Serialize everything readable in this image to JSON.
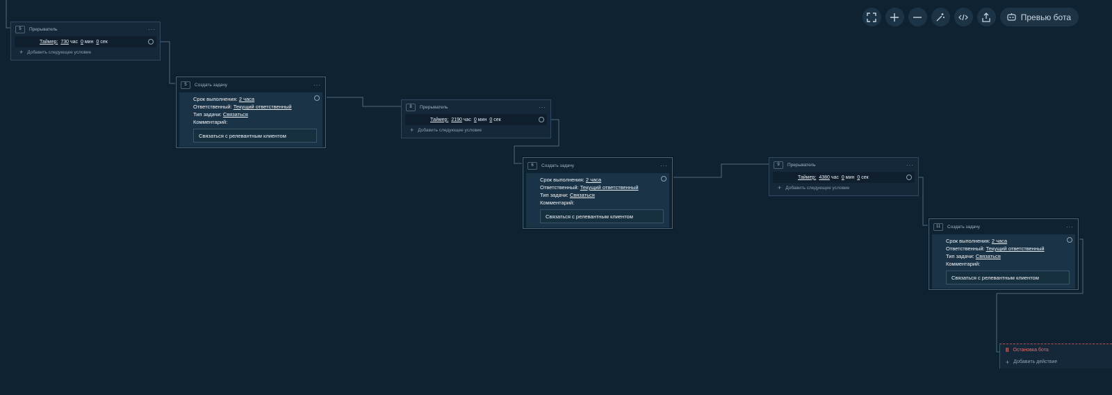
{
  "toolbar": {
    "preview_label": "Превью бота",
    "icons": [
      "fullscreen-icon",
      "zoom-in-icon",
      "zoom-out-icon",
      "magic-wand-icon",
      "code-icon",
      "share-icon",
      "bot-icon"
    ]
  },
  "nodes": {
    "interrupter_5": {
      "badge": "5",
      "title": "Прерыватель",
      "menu": "···",
      "timer_label": "Таймер:",
      "hours_value": "730",
      "hours_unit": "час",
      "minutes_value": "0",
      "minutes_unit": "мин",
      "seconds_value": "0",
      "seconds_unit": "сек",
      "add_condition": "Добавить следующее условие"
    },
    "task_5": {
      "badge": "5",
      "title": "Создать задачу",
      "menu": "···",
      "deadline_label": "Срок выполнения:",
      "deadline_value": "2 часа",
      "responsible_label": "Ответственный:",
      "responsible_value": "Текущий ответственный",
      "type_label": "Тип задачи:",
      "type_value": "Связаться",
      "comment_label": "Комментарий:",
      "comment_value": "Связаться с релевантным клиентом"
    },
    "interrupter_8": {
      "badge": "8",
      "title": "Прерыватель",
      "menu": "···",
      "timer_label": "Таймер:",
      "hours_value": "2190",
      "hours_unit": "час",
      "minutes_value": "0",
      "minutes_unit": "мин",
      "seconds_value": "0",
      "seconds_unit": "сек",
      "add_condition": "Добавить следующее условие"
    },
    "task_6": {
      "badge": "6",
      "title": "Создать задачу",
      "menu": "···",
      "deadline_label": "Срок выполнения:",
      "deadline_value": "2 часа",
      "responsible_label": "Ответственный:",
      "responsible_value": "Текущий ответственный",
      "type_label": "Тип задачи:",
      "type_value": "Связаться",
      "comment_label": "Комментарий:",
      "comment_value": "Связаться с релевантным клиентом"
    },
    "interrupter_9": {
      "badge": "9",
      "title": "Прерыватель",
      "menu": "···",
      "timer_label": "Таймер:",
      "hours_value": "4380",
      "hours_unit": "час",
      "minutes_value": "0",
      "minutes_unit": "мин",
      "seconds_value": "0",
      "seconds_unit": "сек",
      "add_condition": "Добавить следующее условие"
    },
    "task_11": {
      "badge": "11",
      "title": "Создать задачу",
      "menu": "···",
      "deadline_label": "Срок выполнения:",
      "deadline_value": "2 часа",
      "responsible_label": "Ответственный:",
      "responsible_value": "Текущий ответственный",
      "type_label": "Тип задачи:",
      "type_value": "Связаться",
      "comment_label": "Комментарий:",
      "comment_value": "Связаться с релевантным клиентом"
    },
    "stop": {
      "stop_label": "Остановка бота",
      "add_action": "Добавить действие"
    }
  },
  "colors": {
    "background": "#0f2231",
    "node_bg": "#14283a",
    "wire": "#4e6a80",
    "stop_accent": "#e06c6a"
  }
}
